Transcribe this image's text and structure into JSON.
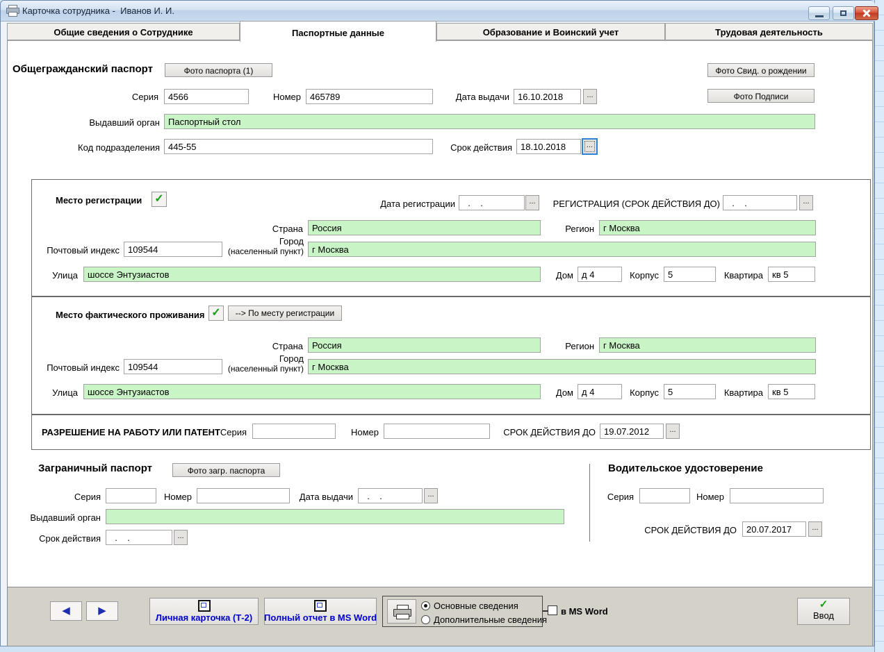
{
  "ui": {
    "dots": "...",
    "check": "✓",
    "prev": "◀",
    "next": "▶"
  },
  "window": {
    "title": "Карточка сотрудника -  Иванов И. И."
  },
  "tabs": [
    {
      "label": "Общие сведения о Сотруднике",
      "active": false
    },
    {
      "label": "Паспортные данные",
      "active": true
    },
    {
      "label": "Образование и Воинский учет",
      "active": false
    },
    {
      "label": "Трудовая деятельность",
      "active": false
    }
  ],
  "civil_passport": {
    "title": "Общегражданский паспорт",
    "photo_button": "Фото паспорта (1)",
    "birth_cert_photo_button": "Фото Свид. о рождении",
    "signature_photo_button": "Фото Подписи",
    "series_label": "Серия",
    "series": "4566",
    "number_label": "Номер",
    "number": "465789",
    "issue_date_label": "Дата выдачи",
    "issue_date": "16.10.2018",
    "issuer_label": "Выдавший орган",
    "issuer": "Паспортный стол",
    "dept_code_label": "Код подразделения",
    "dept_code": "445-55",
    "valid_until_label": "Срок действия",
    "valid_until": "18.10.2018"
  },
  "registration": {
    "title": "Место регистрации",
    "checkbox_checked": "✓",
    "reg_date_label": "Дата регистрации",
    "reg_date": "  .    .",
    "reg_valid_label": "РЕГИСТРАЦИЯ (СРОК ДЕЙСТВИЯ ДО)",
    "reg_valid": "  .    .",
    "country_label": "Страна",
    "country": "Россия",
    "region_label": "Регион",
    "region": "г Москва",
    "postcode_label": "Почтовый индекс",
    "postcode": "109544",
    "city_label_line1": "Город",
    "city_label_line2": "(населенный пункт)",
    "city": "г Москва",
    "street_label": "Улица",
    "street": "шоссе Энтузиастов",
    "house_label": "Дом",
    "house": "д 4",
    "building_label": "Корпус",
    "building": "5",
    "apartment_label": "Квартира",
    "apartment": "кв 5"
  },
  "residence": {
    "title": "Место фактического проживания",
    "checkbox_checked": "✓",
    "copy_button": "--> По месту регистрации",
    "country_label": "Страна",
    "country": "Россия",
    "region_label": "Регион",
    "region": "г Москва",
    "postcode_label": "Почтовый индекс",
    "postcode": "109544",
    "city_label_line1": "Город",
    "city_label_line2": "(населенный пункт)",
    "city": "г Москва",
    "street_label": "Улица",
    "street": "шоссе Энтузиастов",
    "house_label": "Дом",
    "house": "д 4",
    "building_label": "Корпус",
    "building": "5",
    "apartment_label": "Квартира",
    "apartment": "кв 5"
  },
  "work_permit": {
    "title": "РАЗРЕШЕНИЕ НА РАБОТУ ИЛИ ПАТЕНТ",
    "series_label": "Серия",
    "series": "",
    "number_label": "Номер",
    "number": "",
    "valid_label": "СРОК ДЕЙСТВИЯ ДО",
    "valid": "19.07.2012"
  },
  "foreign_passport": {
    "title": "Заграничный паспорт",
    "photo_button": "Фото загр. паспорта",
    "series_label": "Серия",
    "series": "",
    "number_label": "Номер",
    "number": "",
    "issue_date_label": "Дата выдачи",
    "issue_date": "  .    .",
    "issuer_label": "Выдавший орган",
    "issuer": "",
    "valid_label": "Срок действия",
    "valid": "  .    ."
  },
  "driver_license": {
    "title": "Водительское удостоверение",
    "series_label": "Серия",
    "series": "",
    "number_label": "Номер",
    "number": "",
    "valid_label": "СРОК ДЕЙСТВИЯ ДО",
    "valid": "20.07.2017"
  },
  "footer": {
    "personal_card_button": "Личная карточка (Т-2)",
    "full_report_button": "Полный отчет в MS Word",
    "radio_main": "Основные сведения",
    "radio_additional": "Дополнительные сведения",
    "ms_word_checkbox": "в MS Word",
    "submit_button": "Ввод"
  },
  "colors": {
    "field_green": "#c9f5c6",
    "close_red": "#c23a22",
    "footer_bg": "#d4d1c9",
    "report_link_blue": "#0000cf",
    "check_green": "#12a012"
  }
}
